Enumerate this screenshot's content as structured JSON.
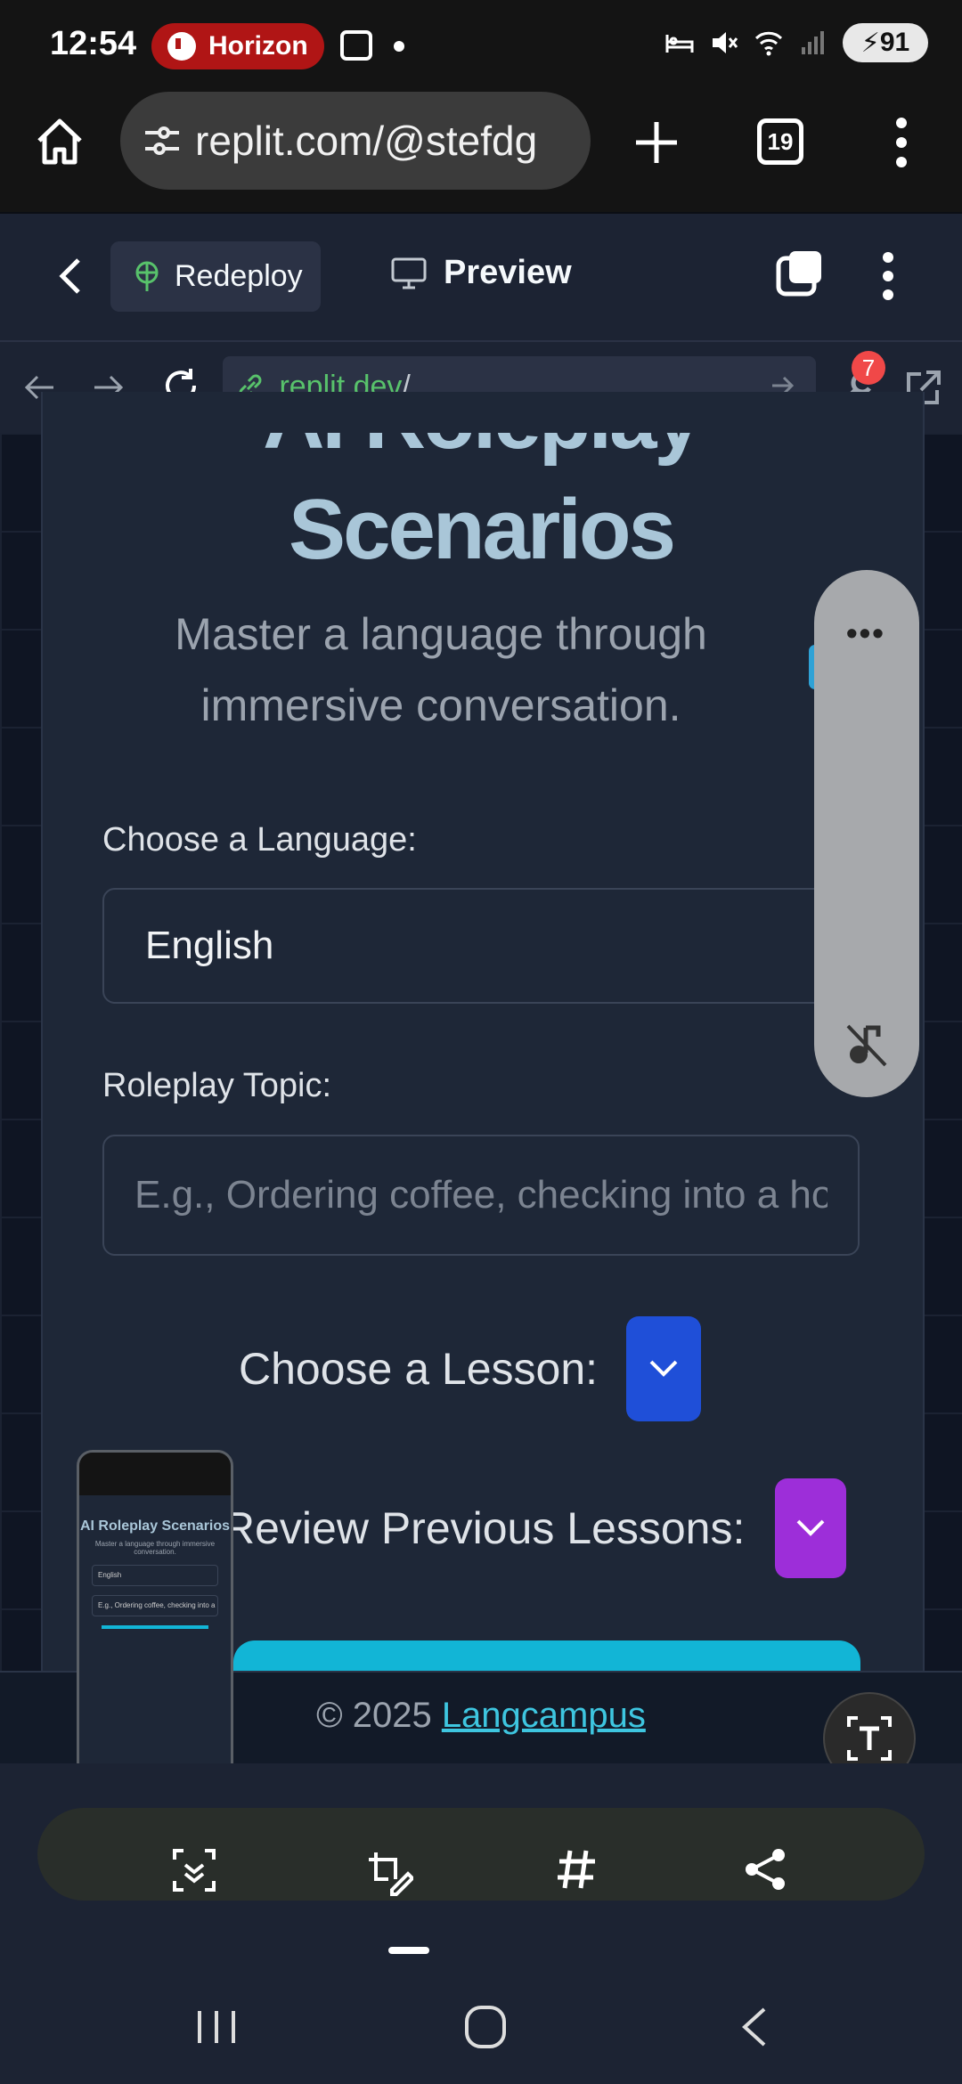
{
  "status_bar": {
    "time": "12:54",
    "app_badge": "Horizon",
    "battery": "91"
  },
  "browser": {
    "url": "replit.com/@stefdg",
    "tab_count": "19"
  },
  "replit": {
    "redeploy_label": "Redeploy",
    "preview_label": "Preview",
    "address": ".replit.dev",
    "address_suffix": "/",
    "devtools_badge": "7"
  },
  "page": {
    "title_line1": "AI Roleplay",
    "title_line2": "Scenarios",
    "subtitle": "Master a language through immersive conversation.",
    "language_label": "Choose a Language:",
    "language_value": "English",
    "topic_label": "Roleplay Topic:",
    "topic_placeholder": "E.g., Ordering coffee, checking into a hotel",
    "lesson_label": "Choose a Lesson:",
    "review_label": "Review Previous Lessons:",
    "footer_prefix": "© 2025 ",
    "footer_link": "Langcampus"
  },
  "float_panel": {
    "more_label": "•••"
  },
  "thumbnail": {
    "title": "AI Roleplay Scenarios",
    "subtitle": "Master a language through immersive conversation.",
    "field1": "English",
    "field2": "E.g., Ordering coffee, checking into a"
  },
  "dock": {
    "icons": [
      "scroll-capture-icon",
      "edit-crop-icon",
      "hashtag-icon",
      "share-icon"
    ]
  },
  "colors": {
    "accent_blue": "#1f4fd8",
    "accent_purple": "#9d2ed9",
    "accent_cyan": "#12b5d6",
    "link_green": "#58c26b",
    "badge_red": "#b01515"
  }
}
